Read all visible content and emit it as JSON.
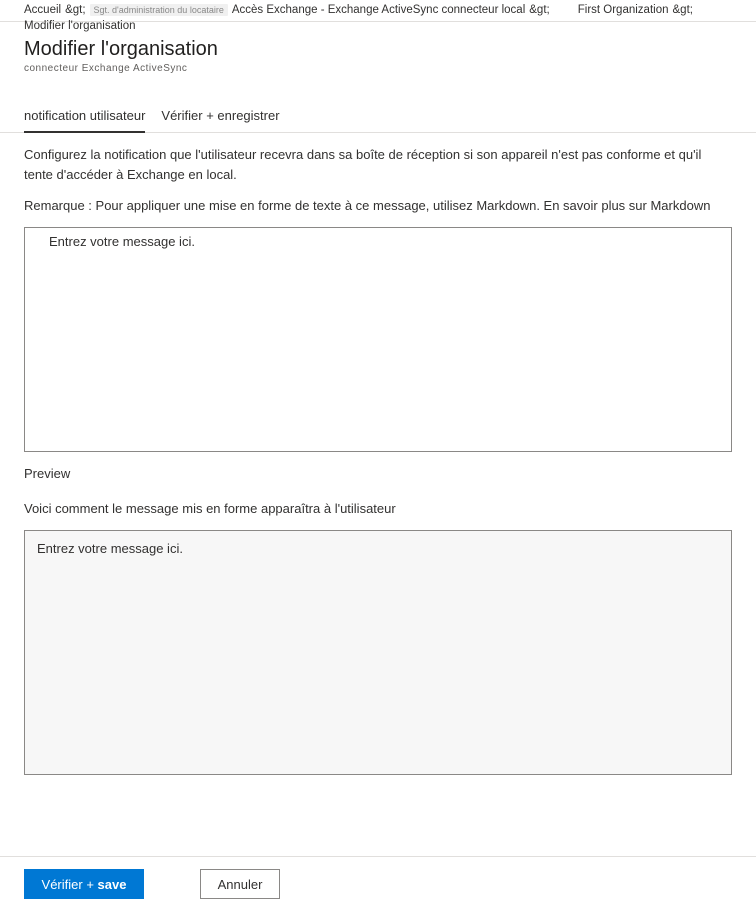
{
  "breadcrumb": {
    "home": "Accueil",
    "sep1": "&gt;",
    "tenant_admin": "Sgt. d'administration du locataire",
    "exchange_access": "Accès Exchange - Exchange ActiveSync connecteur local",
    "sep2": "&gt;",
    "first_org": "First Organization",
    "sep3": "&gt;",
    "modify_org": "Modifier l'organisation"
  },
  "header": {
    "title": "Modifier l'organisation",
    "subtitle": "connecteur Exchange ActiveSync"
  },
  "tabs": [
    {
      "label": "notification utilisateur",
      "active": true
    },
    {
      "label": "Vérifier + enregistrer",
      "active": false
    }
  ],
  "content": {
    "description": "Configurez la notification que l'utilisateur recevra dans sa boîte de réception si son appareil n'est pas conforme et qu'il tente d'accéder à Exchange en local.",
    "remark": "Remarque : Pour appliquer une mise en forme de texte à ce message, utilisez Markdown. En savoir plus sur Markdown",
    "editor_placeholder": "Entrez votre message ici.",
    "preview_label": "Preview",
    "preview_description": "Voici comment le message mis en forme apparaîtra à l'utilisateur",
    "preview_content": "Entrez votre message ici."
  },
  "footer": {
    "primary_prefix": "Vérifier + ",
    "primary_bold": "save",
    "cancel": "Annuler"
  }
}
